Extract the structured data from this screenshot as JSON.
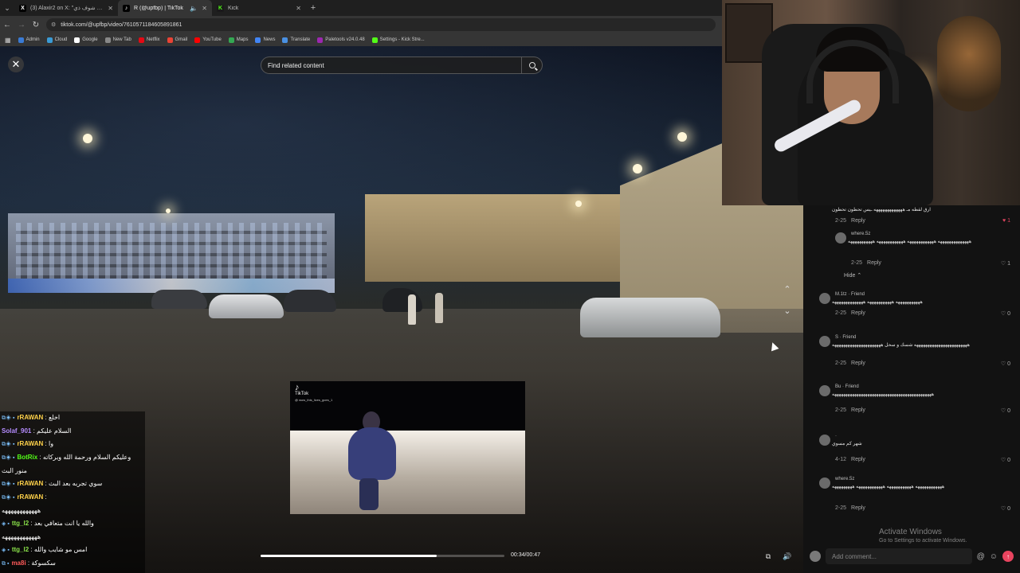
{
  "browser": {
    "tabs": [
      {
        "title": "(3) Alaxir2 on X: \"بس أبغى شوف ذي",
        "favicon": "X",
        "color": "#000000",
        "active": false
      },
      {
        "title": "R (@upfbp) | TikTok",
        "favicon": "♪",
        "color": "#000000",
        "active": true
      },
      {
        "title": "Kick",
        "favicon": "K",
        "color": "#53fc18",
        "active": false
      }
    ],
    "url": "tiktok.com/@upfbp/video/7610571184605891861",
    "bookmarks": [
      {
        "label": "Admin",
        "color": "#3a7bd5"
      },
      {
        "label": "Cloud",
        "color": "#3a9bd5"
      },
      {
        "label": "Google",
        "color": "#ffffff"
      },
      {
        "label": "New Tab",
        "color": "#888888"
      },
      {
        "label": "Netflix",
        "color": "#e50914"
      },
      {
        "label": "Gmail",
        "color": "#ea4335"
      },
      {
        "label": "YouTube",
        "color": "#ff0000"
      },
      {
        "label": "Maps",
        "color": "#34a853"
      },
      {
        "label": "News",
        "color": "#4285f4"
      },
      {
        "label": "Translate",
        "color": "#4a90e2"
      },
      {
        "label": "Paletools v24.0.48",
        "color": "#9c27b0"
      },
      {
        "label": "Settings - Kick Stre...",
        "color": "#53fc18"
      }
    ]
  },
  "player": {
    "search_placeholder": "Find related content",
    "pip_brand": "TikTok",
    "pip_handle": "@ wow_this_lives_goes_1",
    "time": "00:34/00:47",
    "progress": 0.723
  },
  "chat": [
    {
      "user": "rRAWAN",
      "color": "#ffd24a",
      "text": "اخلع",
      "badges": "⧉◈ ▪"
    },
    {
      "user": "Solaf_901",
      "color": "#b58cff",
      "text": "السلام عليكم",
      "badges": ""
    },
    {
      "user": "rRAWAN",
      "color": "#ffd24a",
      "text": "وا",
      "badges": "⧉◈ ▪"
    },
    {
      "user": "BotRix",
      "color": "#53fc18",
      "text": "وعليكم السلام ورحمة الله وبركاته",
      "badges": "⧉◈ ▪"
    },
    {
      "user": "",
      "color": "#ffffff",
      "text": "منور البث",
      "badges": ""
    },
    {
      "user": "rRAWAN",
      "color": "#ffd24a",
      "text": "سوي تجربه بعد البث",
      "badges": "⧉◈ ▪"
    },
    {
      "user": "rRAWAN",
      "color": "#ffd24a",
      "text": "",
      "badges": "⧉◈ ▪"
    },
    {
      "user": "",
      "color": "#ffffff",
      "text": "ههههههههههههه",
      "badges": ""
    },
    {
      "user": "ttg_l2",
      "color": "#8be34a",
      "text": "والله يا انت متعافي بعد",
      "badges": "◈ ▪"
    },
    {
      "user": "",
      "color": "#ffffff",
      "text": "ههههههههههههه",
      "badges": ""
    },
    {
      "user": "ttg_l2",
      "color": "#8be34a",
      "text": "امس مو شايب والله",
      "badges": "◈ ▪"
    },
    {
      "user": "ma8i",
      "color": "#ff5a5a",
      "text": "سكسوكة",
      "badges": "⧉ ▪"
    }
  ],
  "comments": {
    "items": [
      {
        "name": "",
        "body": "ارق لقطه مـ هههههههههههههه ـيس تحطون تحطون",
        "date": "2-25",
        "reply": "Reply",
        "likes": "1",
        "liked": true
      },
      {
        "name": "where.5z",
        "body": "ههههههههههههههه ههههههههههههه ههههههههههههه هههههههههههه",
        "date": "2-25",
        "reply": "Reply",
        "likes": "1",
        "liked": false
      },
      {
        "name": "M.1tz · Friend",
        "body": "هههههههههههه هههههههههههه ههههههههههههههه",
        "date": "2-25",
        "reply": "Reply",
        "likes": "0",
        "liked": false
      },
      {
        "name": "S · Friend",
        "body": "ههههههههههههههههههههههههه شسك و سحل ههههههههههههههههههههههه",
        "date": "2-25",
        "reply": "Reply",
        "likes": "0",
        "liked": false
      },
      {
        "name": "Bu · Friend",
        "body": "هههههههههههههههههههههههههههههههههههههههههههههه",
        "date": "2-25",
        "reply": "Reply",
        "likes": "0",
        "liked": false
      },
      {
        "name": "·",
        "body": "شهر كم مسوي",
        "date": "4-12",
        "reply": "Reply",
        "likes": "0",
        "liked": false
      },
      {
        "name": "where.5z",
        "body": "ههههههههههههه هههههههههههه ههههههههههههه هههههههههه",
        "date": "2-25",
        "reply": "Reply",
        "likes": "0",
        "liked": false
      }
    ],
    "hide_label": "Hide ⌃",
    "add_placeholder": "Add comment...",
    "windows_title": "Activate Windows",
    "windows_sub": "Go to Settings to activate Windows."
  },
  "icons": {
    "close": "close-icon",
    "search": "search-icon",
    "up": "chevron-up-icon",
    "down": "chevron-down-icon",
    "volume": "volume-icon",
    "pip": "picture-in-picture-icon",
    "mention": "at-icon",
    "emoji": "emoji-icon",
    "send": "send-icon"
  }
}
